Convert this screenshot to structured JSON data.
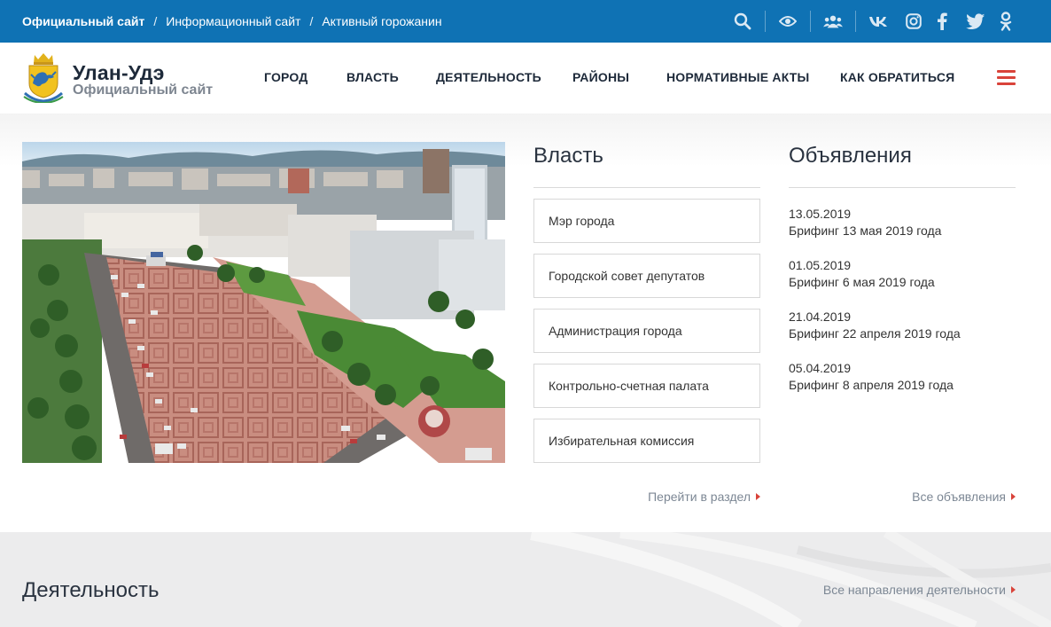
{
  "topbar": {
    "crumbs": [
      "Официальный сайт",
      "Информационный сайт",
      "Активный горожанин"
    ],
    "separator": "/",
    "icons": [
      "search-icon",
      "eye-icon",
      "users-icon",
      "vk-icon",
      "instagram-icon",
      "facebook-icon",
      "twitter-icon",
      "odnoklassniki-icon"
    ]
  },
  "header": {
    "brand_name": "Улан-Удэ",
    "brand_sub": "Официальный сайт",
    "nav": [
      "ГОРОД",
      "ВЛАСТЬ",
      "ДЕЯТЕЛЬНОСТЬ",
      "РАЙОНЫ",
      "НОРМАТИВНЫЕ АКТЫ",
      "КАК ОБРАТИТЬСЯ"
    ]
  },
  "vlast": {
    "title": "Власть",
    "items": [
      "Мэр города",
      "Городской совет депутатов",
      "Администрация города",
      "Контрольно-счетная палата",
      "Избирательная комиссия"
    ],
    "more": "Перейти в раздел"
  },
  "announcements": {
    "title": "Объявления",
    "items": [
      {
        "date": "13.05.2019",
        "text": "Брифинг 13 мая 2019 года"
      },
      {
        "date": "01.05.2019",
        "text": "Брифинг 6 мая 2019 года"
      },
      {
        "date": "21.04.2019",
        "text": "Брифинг 22 апреля 2019 года"
      },
      {
        "date": "05.04.2019",
        "text": "Брифинг 8 апреля 2019 года"
      }
    ],
    "more": "Все объявления"
  },
  "activity": {
    "title": "Деятельность",
    "more": "Все направления деятельности"
  },
  "colors": {
    "topbar": "#0f72b4",
    "accent": "#d9433a"
  }
}
